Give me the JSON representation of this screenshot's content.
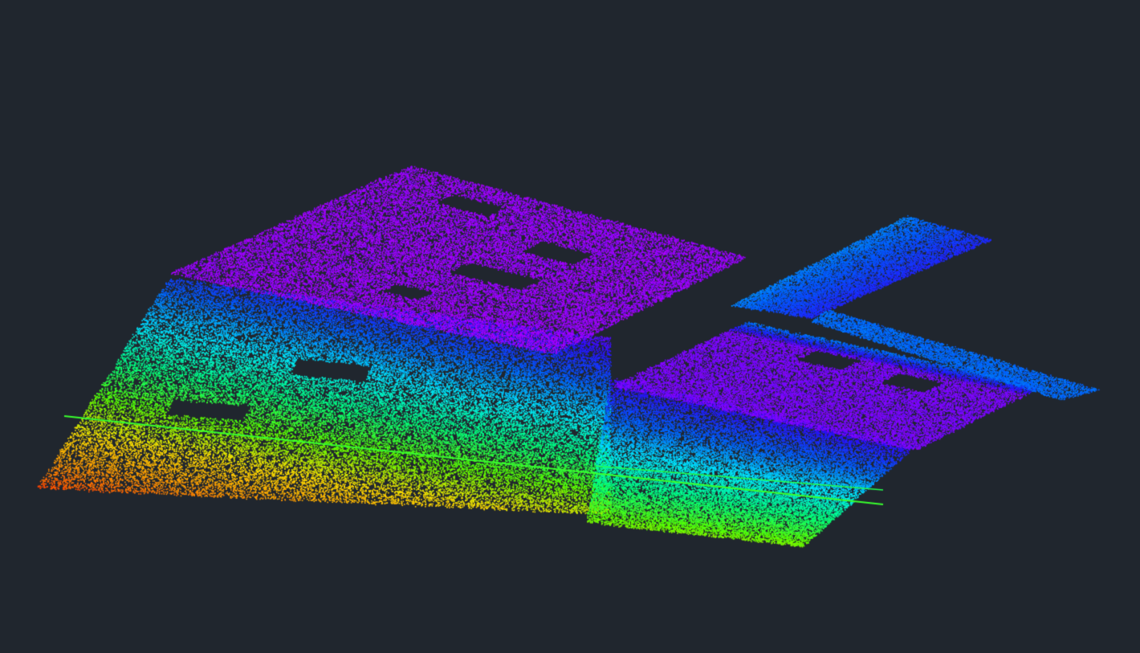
{
  "viewer": {
    "background_color": "#20262e",
    "colormap": [
      "#ff1a00",
      "#ff8a00",
      "#ffe000",
      "#59ff00",
      "#00ff80",
      "#00e8ff",
      "#0060ff",
      "#2a10ff",
      "#b000ff"
    ]
  }
}
